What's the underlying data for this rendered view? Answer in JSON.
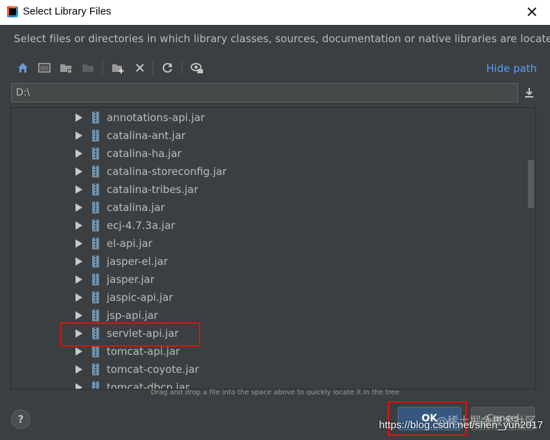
{
  "window": {
    "title": "Select Library Files",
    "close_glyph": "✕"
  },
  "description": "Select files or directories in which library classes, sources, documentation or native libraries are located",
  "toolbar": {
    "buttons": [
      "home-icon",
      "desktop-icon",
      "project-folder-icon",
      "module-folder-icon",
      "new-folder-icon",
      "delete-icon",
      "refresh-icon",
      "show-hidden-icon"
    ],
    "hide_path_label": "Hide path"
  },
  "path": {
    "value": "D:\\"
  },
  "tree": {
    "items": [
      "annotations-api.jar",
      "catalina-ant.jar",
      "catalina-ha.jar",
      "catalina-storeconfig.jar",
      "catalina-tribes.jar",
      "catalina.jar",
      "ecj-4.7.3a.jar",
      "el-api.jar",
      "jasper-el.jar",
      "jasper.jar",
      "jaspic-api.jar",
      "jsp-api.jar",
      "servlet-api.jar",
      "tomcat-api.jar",
      "tomcat-coyote.jar",
      "tomcat-dbcp.jar"
    ],
    "highlighted_item": "servlet-api.jar"
  },
  "hint": "Drag and drop a file into the space above to quickly locate it in the tree",
  "buttons": {
    "help": "?",
    "ok": "OK",
    "cancel": "Cancel"
  },
  "watermark": {
    "url": "https://blog.csdn.net/shen_yun2017",
    "cn": "@稀土掘金技术社区"
  },
  "colors": {
    "background": "#3c3f41",
    "link": "#589df6",
    "highlight_box": "#e01010",
    "ok_button": "#365880"
  }
}
